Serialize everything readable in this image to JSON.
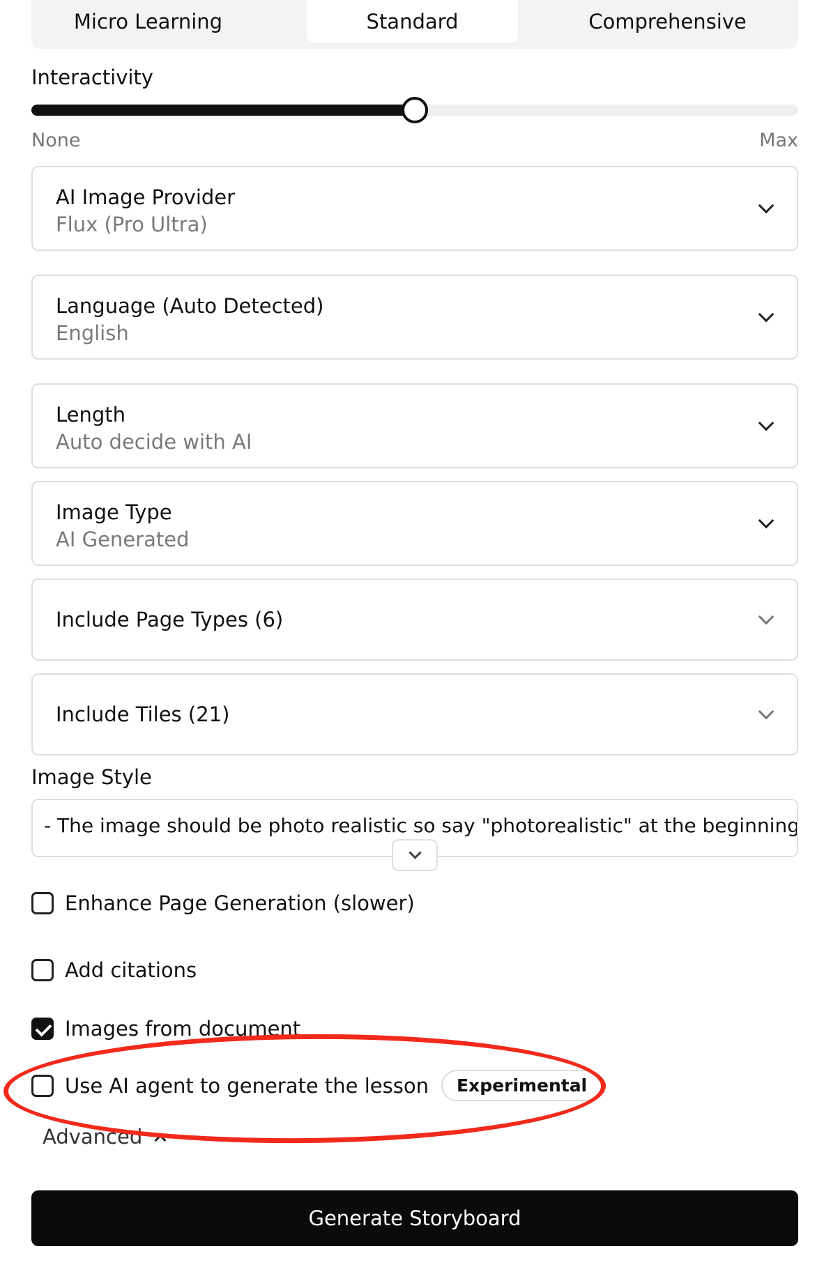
{
  "depth_tabs": [
    {
      "label": "Micro Learning",
      "active": false
    },
    {
      "label": "Standard",
      "active": true
    },
    {
      "label": "Comprehensive",
      "active": false
    }
  ],
  "interactivity": {
    "label": "Interactivity",
    "min_label": "None",
    "max_label": "Max",
    "level_percent": 50
  },
  "dropdowns": {
    "image_provider": {
      "title": "AI Image Provider",
      "value": "Flux (Pro Ultra)"
    },
    "language": {
      "title": "Language (Auto Detected)",
      "value": "English"
    },
    "length": {
      "title": "Length",
      "value": "Auto decide with AI"
    },
    "image_type": {
      "title": "Image Type",
      "value": "AI Generated"
    },
    "page_types": {
      "title": "Include Page Types (6)"
    },
    "tiles": {
      "title": "Include Tiles (21)"
    }
  },
  "image_style": {
    "label": "Image Style",
    "text": "- The image should be photo realistic so say \"photorealistic\" at the beginning of"
  },
  "options": [
    {
      "label": "Enhance Page Generation (slower)",
      "checked": false
    },
    {
      "label": "Add citations",
      "checked": false
    },
    {
      "label": "Images from document",
      "checked": true
    },
    {
      "label": "Use AI agent to generate the lesson",
      "checked": false,
      "badge": "Experimental"
    }
  ],
  "advanced_label": "Advanced",
  "generate_button": "Generate Storyboard",
  "colors": {
    "primary": "#0a0a0a",
    "annotation": "#f22a1c",
    "muted_text": "#7a7a7a"
  },
  "icons": {
    "dropdown": "chevron-down-icon",
    "advanced": "chevron-up-icon",
    "checkbox_checked": "checkmark-icon"
  }
}
